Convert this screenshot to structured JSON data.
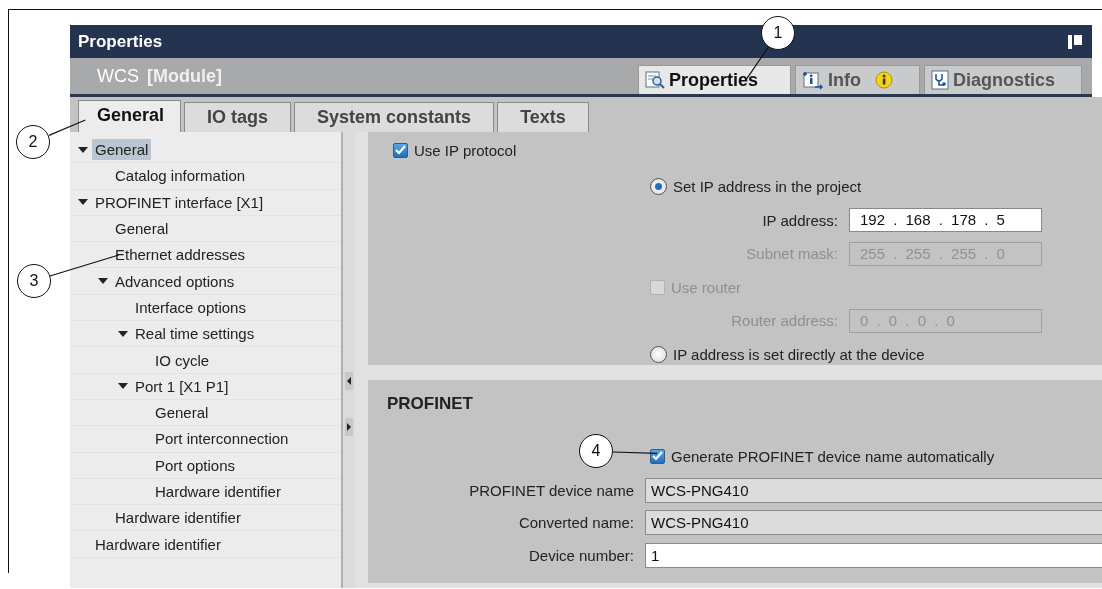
{
  "window": {
    "title": "Properties"
  },
  "object": {
    "name": "WCS",
    "type": "[Module]"
  },
  "view_tabs": [
    {
      "label": "Properties",
      "selected": true,
      "kind": "properties"
    },
    {
      "label": "Info",
      "selected": false,
      "kind": "info"
    },
    {
      "label": "Diagnostics",
      "selected": false,
      "kind": "diagnostics"
    }
  ],
  "tabs": [
    {
      "label": "General",
      "selected": true
    },
    {
      "label": "IO tags",
      "selected": false
    },
    {
      "label": "System constants",
      "selected": false
    },
    {
      "label": "Texts",
      "selected": false
    }
  ],
  "tree": [
    {
      "label": "General",
      "selected": true,
      "expanded": true,
      "children": [
        {
          "label": "Catalog information",
          "selected": false
        }
      ]
    },
    {
      "label": "PROFINET interface [X1]",
      "selected": false,
      "expanded": true,
      "children": [
        {
          "label": "General",
          "selected": false
        },
        {
          "label": "Ethernet addresses",
          "selected": false
        },
        {
          "label": "Advanced options",
          "selected": false,
          "expanded": true,
          "children": [
            {
              "label": "Interface options",
              "selected": false
            },
            {
              "label": "Real time settings",
              "selected": false,
              "expanded": true,
              "children": [
                {
                  "label": "IO cycle",
                  "selected": false
                }
              ]
            },
            {
              "label": "Port 1 [X1 P1]",
              "selected": false,
              "expanded": true,
              "children": [
                {
                  "label": "General",
                  "selected": false
                },
                {
                  "label": "Port interconnection",
                  "selected": false
                },
                {
                  "label": "Port options",
                  "selected": false
                },
                {
                  "label": "Hardware identifier",
                  "selected": false
                }
              ]
            }
          ]
        },
        {
          "label": "Hardware identifier",
          "selected": false
        }
      ]
    },
    {
      "label": "Hardware identifier",
      "selected": false
    }
  ],
  "ethernet": {
    "use_ip": {
      "label": "Use IP protocol",
      "checked": true
    },
    "rows": [
      {
        "kind": "radio",
        "label": "Set IP address in the project",
        "selected": true
      },
      {
        "kind": "field",
        "label": "IP address:",
        "value": "192 . 168 . 178 . 5",
        "disabled": false
      },
      {
        "kind": "field",
        "label": "Subnet mask:",
        "value": "255 . 255 . 255 . 0",
        "disabled": true
      },
      {
        "kind": "checkbox",
        "label": "Use router",
        "checked": false,
        "disabled": true
      },
      {
        "kind": "field",
        "label": "Router address:",
        "value": "0 . 0 . 0 . 0",
        "disabled": true
      },
      {
        "kind": "radio",
        "label": "IP address is set directly at the device",
        "selected": false
      }
    ]
  },
  "profinet": {
    "title": "PROFINET",
    "auto_name": {
      "label": "Generate PROFINET device name automatically",
      "checked": true
    },
    "fields": [
      {
        "label": "PROFINET device name",
        "value": "WCS-PNG410",
        "readonly": true
      },
      {
        "label": "Converted name:",
        "value": "WCS-PNG410",
        "readonly": true
      },
      {
        "label": "Device number:",
        "value": "1",
        "readonly": false
      }
    ]
  },
  "callouts": [
    {
      "number": "1"
    },
    {
      "number": "2"
    },
    {
      "number": "3"
    },
    {
      "number": "4"
    }
  ]
}
